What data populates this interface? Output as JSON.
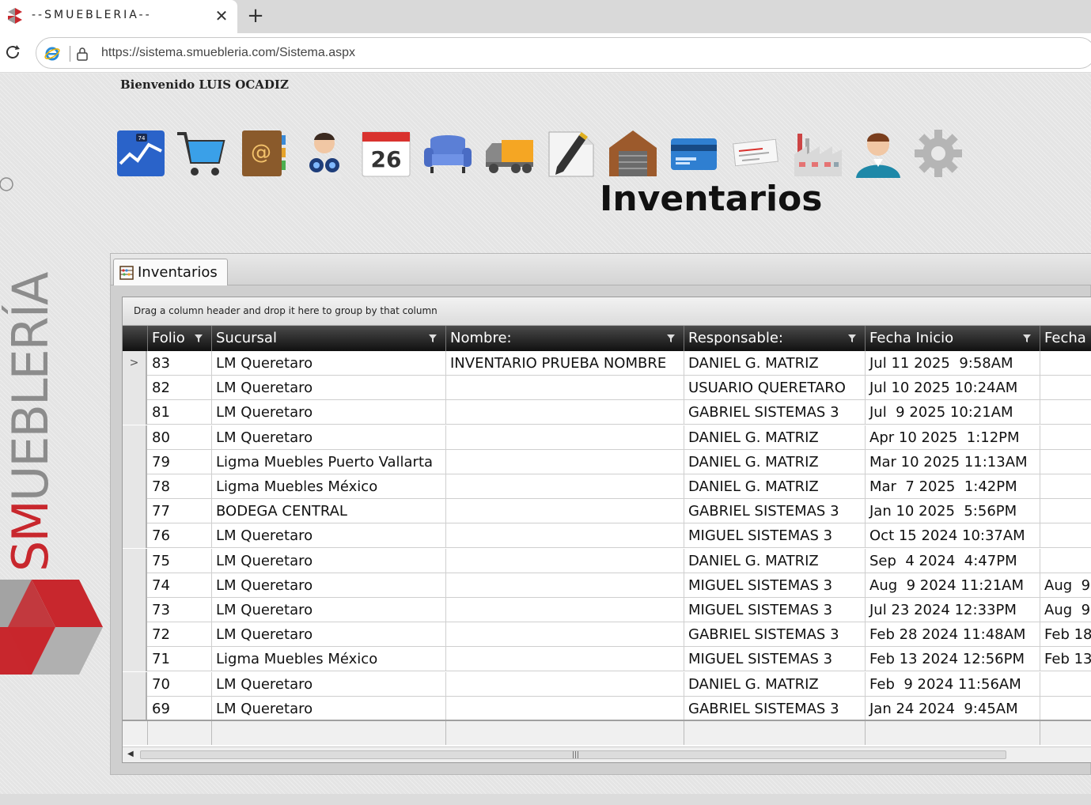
{
  "browser": {
    "tab_title": "--SMUEBLERIA--",
    "close_glyph": "✕",
    "new_tab_glyph": "+",
    "url": "https://sistema.smuebleria.com/Sistema.aspx"
  },
  "page": {
    "welcome": "Bienvenido LUIS OCADIZ",
    "title": "Inventarios",
    "nav_icons": [
      "dashboard-chart-icon",
      "shopping-cart-icon",
      "address-book-icon",
      "binoculars-user-icon",
      "calendar-icon",
      "sofa-icon",
      "delivery-truck-icon",
      "notepad-pencil-icon",
      "warehouse-icon",
      "credit-card-icon",
      "check-icon",
      "factory-icon",
      "user-icon",
      "settings-gear-icon"
    ],
    "calendar_day": "26",
    "chart_badge": "74"
  },
  "panel": {
    "tab_label": "Inventarios"
  },
  "grid": {
    "group_hint": "Drag a column header and drop it here to group by that column",
    "columns": [
      "Folio",
      "Sucursal",
      "Nombre:",
      "Responsable:",
      "Fecha Inicio",
      "Fecha"
    ],
    "selected_row_marker": ">",
    "rows": [
      {
        "folio": "83",
        "sucursal": "LM Queretaro",
        "nombre": "INVENTARIO PRUEBA NOMBRE",
        "responsable": "DANIEL G. MATRIZ",
        "fecha_inicio": "Jul 11 2025  9:58AM",
        "fecha": ""
      },
      {
        "folio": "82",
        "sucursal": "LM Queretaro",
        "nombre": "",
        "responsable": "USUARIO QUERETARO",
        "fecha_inicio": "Jul 10 2025 10:24AM",
        "fecha": ""
      },
      {
        "folio": "81",
        "sucursal": "LM Queretaro",
        "nombre": "",
        "responsable": "GABRIEL SISTEMAS 3",
        "fecha_inicio": "Jul  9 2025 10:21AM",
        "fecha": ""
      },
      {
        "folio": "80",
        "sucursal": "LM Queretaro",
        "nombre": "",
        "responsable": "DANIEL G. MATRIZ",
        "fecha_inicio": "Apr 10 2025  1:12PM",
        "fecha": ""
      },
      {
        "folio": "79",
        "sucursal": "Ligma Muebles Puerto Vallarta",
        "nombre": "",
        "responsable": "DANIEL G. MATRIZ",
        "fecha_inicio": "Mar 10 2025 11:13AM",
        "fecha": ""
      },
      {
        "folio": "78",
        "sucursal": "Ligma Muebles México",
        "nombre": "",
        "responsable": "DANIEL G. MATRIZ",
        "fecha_inicio": "Mar  7 2025  1:42PM",
        "fecha": ""
      },
      {
        "folio": "77",
        "sucursal": "BODEGA CENTRAL",
        "nombre": "",
        "responsable": "GABRIEL SISTEMAS 3",
        "fecha_inicio": "Jan 10 2025  5:56PM",
        "fecha": ""
      },
      {
        "folio": "76",
        "sucursal": "LM Queretaro",
        "nombre": "",
        "responsable": "MIGUEL SISTEMAS 3",
        "fecha_inicio": "Oct 15 2024 10:37AM",
        "fecha": ""
      },
      {
        "folio": "75",
        "sucursal": "LM Queretaro",
        "nombre": "",
        "responsable": "DANIEL G. MATRIZ",
        "fecha_inicio": "Sep  4 2024  4:47PM",
        "fecha": ""
      },
      {
        "folio": "74",
        "sucursal": "LM Queretaro",
        "nombre": "",
        "responsable": "MIGUEL SISTEMAS 3",
        "fecha_inicio": "Aug  9 2024 11:21AM",
        "fecha": "Aug  9"
      },
      {
        "folio": "73",
        "sucursal": "LM Queretaro",
        "nombre": "",
        "responsable": "MIGUEL SISTEMAS 3",
        "fecha_inicio": "Jul 23 2024 12:33PM",
        "fecha": "Aug  9"
      },
      {
        "folio": "72",
        "sucursal": "LM Queretaro",
        "nombre": "",
        "responsable": "GABRIEL SISTEMAS 3",
        "fecha_inicio": "Feb 28 2024 11:48AM",
        "fecha": "Feb 18"
      },
      {
        "folio": "71",
        "sucursal": "Ligma Muebles México",
        "nombre": "",
        "responsable": "MIGUEL SISTEMAS 3",
        "fecha_inicio": "Feb 13 2024 12:56PM",
        "fecha": "Feb 13"
      },
      {
        "folio": "70",
        "sucursal": "LM Queretaro",
        "nombre": "",
        "responsable": "DANIEL G. MATRIZ",
        "fecha_inicio": "Feb  9 2024 11:56AM",
        "fecha": ""
      },
      {
        "folio": "69",
        "sucursal": "LM Queretaro",
        "nombre": "",
        "responsable": "GABRIEL SISTEMAS 3",
        "fecha_inicio": "Jan 24 2024  9:45AM",
        "fecha": ""
      }
    ]
  },
  "colors": {
    "brand_red": "#c8272d",
    "brand_gray": "#8c8c8c",
    "header_dark": "#1a1a1a"
  }
}
